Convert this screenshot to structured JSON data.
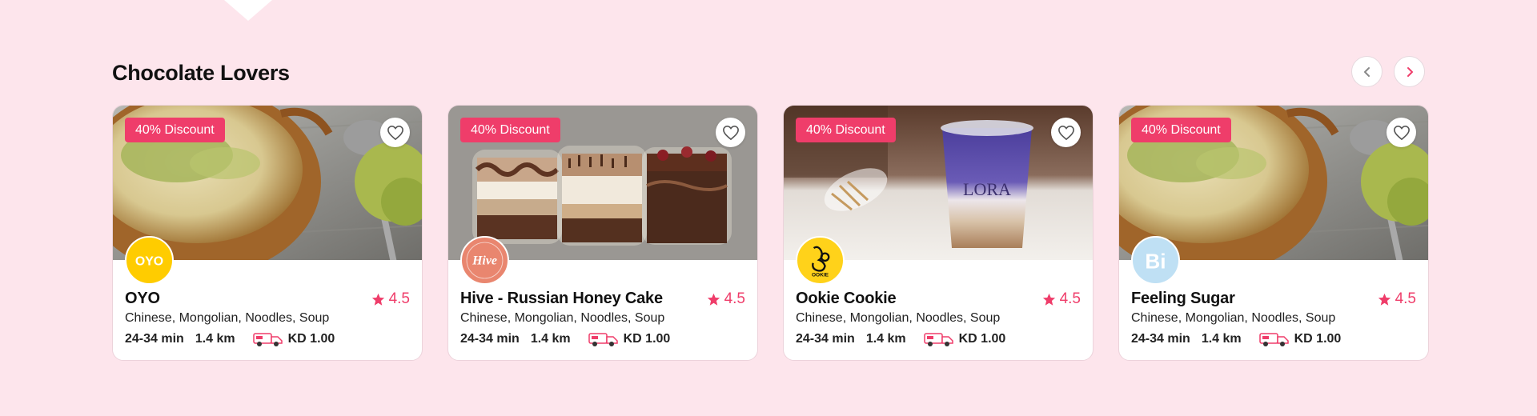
{
  "section": {
    "title": "Chocolate Lovers"
  },
  "colors": {
    "accent": "#ef3d6a",
    "background": "#fde5ec"
  },
  "cards": [
    {
      "name": "OYO",
      "discount": "40% Discount",
      "rating": "4.5",
      "cuisines": "Chinese, Mongolian, Noodles, Soup",
      "time": "24-34 min",
      "distance": "1.4 km",
      "fee": "KD 1.00",
      "logo_text": "OYO"
    },
    {
      "name": "Hive - Russian Honey Cake",
      "discount": "40% Discount",
      "rating": "4.5",
      "cuisines": "Chinese, Mongolian, Noodles, Soup",
      "time": "24-34 min",
      "distance": "1.4 km",
      "fee": "KD 1.00",
      "logo_text": "Hive"
    },
    {
      "name": "Ookie Cookie",
      "discount": "40% Discount",
      "rating": "4.5",
      "cuisines": "Chinese, Mongolian, Noodles, Soup",
      "time": "24-34 min",
      "distance": "1.4 km",
      "fee": "KD 1.00",
      "logo_text": "OOKIE"
    },
    {
      "name": "Feeling Sugar",
      "discount": "40% Discount",
      "rating": "4.5",
      "cuisines": "Chinese, Mongolian, Noodles, Soup",
      "time": "24-34 min",
      "distance": "1.4 km",
      "fee": "KD 1.00",
      "logo_text": "Bi"
    }
  ],
  "icons": {
    "prev": "chevron-left-icon",
    "next": "chevron-right-icon",
    "favorite": "heart-icon",
    "rating": "star-icon",
    "delivery": "delivery-truck-icon"
  }
}
